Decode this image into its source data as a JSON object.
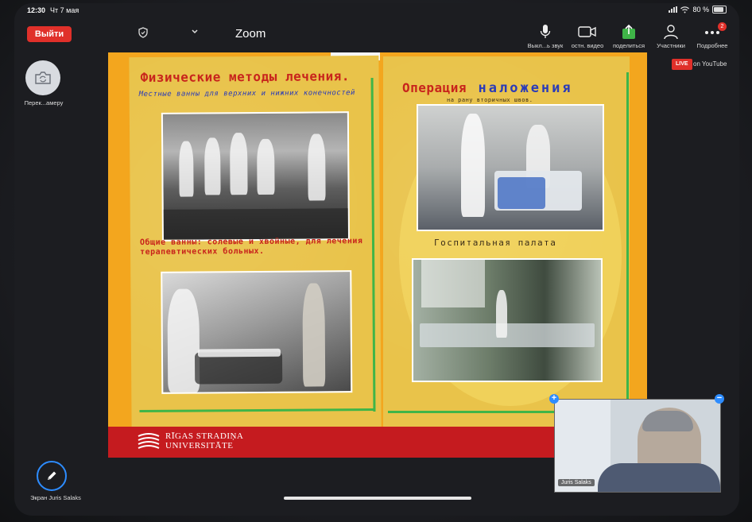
{
  "status": {
    "time": "12:30",
    "date": "Чт 7 мая",
    "battery": "80 %"
  },
  "top_bar": {
    "leave_label": "Выйти",
    "title": "Zoom",
    "tools": [
      {
        "label": "Выкл...ь звук",
        "icon": "mic-icon"
      },
      {
        "label": "остн. видео",
        "icon": "video-camera-icon"
      },
      {
        "label": "поделиться",
        "icon": "share-screen-icon"
      },
      {
        "label": "Участники",
        "icon": "participants-icon"
      },
      {
        "label": "Подробнее",
        "icon": "more-icon",
        "badge": "2"
      }
    ]
  },
  "side": {
    "switch_camera_label": "Перек...амеру",
    "annotate_label": "Экран Juris Salaks"
  },
  "live": {
    "badge": "LIVE",
    "text": "on YouTube"
  },
  "album": {
    "left": {
      "title": "Физические методы лечения.",
      "subtitle": "Местные ванны для верхних и нижних конечностей",
      "caption": "Общие ванны: солевые и хвойные, для лечения терапевтических больных."
    },
    "right": {
      "title_a": "Операция",
      "title_b": "наложения",
      "subtitle": "на рану вторичных швов.",
      "caption": "Госпитальная палата"
    }
  },
  "brand": {
    "line1": "RĪGAS STRADIŅA",
    "line2": "UNIVERSITĀTE"
  },
  "video": {
    "name": "Juris Salaks"
  }
}
